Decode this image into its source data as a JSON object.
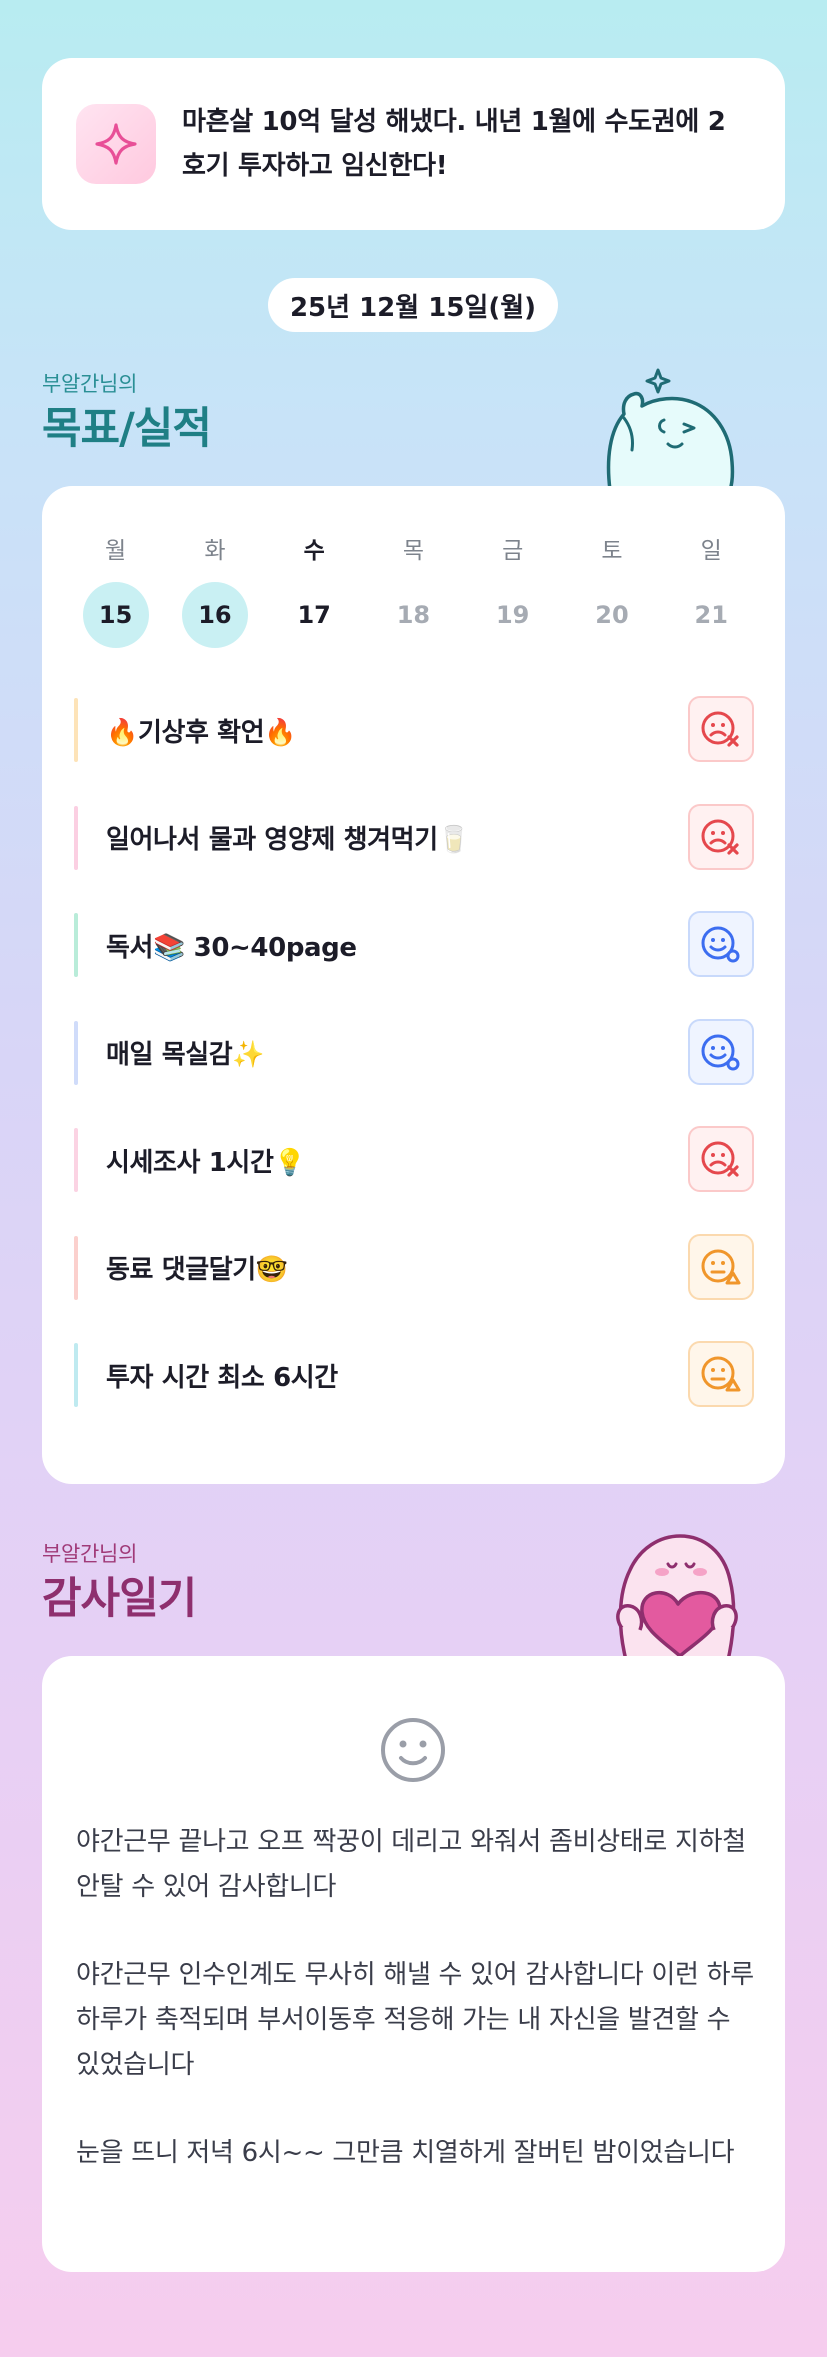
{
  "goal_banner": {
    "icon": "sparkle-icon",
    "text": "마흔살 10억 달성 해냈다. 내년 1월에 수도권에 2호기 투자하고 임신한다!"
  },
  "date": "25년 12월 15일(월)",
  "goals": {
    "owner": "부알간님의",
    "title": "목표/실적",
    "week": [
      {
        "day": "월",
        "date": "15",
        "state": "done"
      },
      {
        "day": "화",
        "date": "16",
        "state": "done"
      },
      {
        "day": "수",
        "date": "17",
        "state": "today"
      },
      {
        "day": "목",
        "date": "18",
        "state": "future"
      },
      {
        "day": "금",
        "date": "19",
        "state": "future"
      },
      {
        "day": "토",
        "date": "20",
        "state": "future"
      },
      {
        "day": "일",
        "date": "21",
        "state": "future"
      }
    ],
    "tasks": [
      {
        "label": "🔥기상후 확언🔥",
        "status": "fail",
        "bar_color": "#fde3b8"
      },
      {
        "label": "일어나서 물과 영양제 챙겨먹기🥛",
        "status": "fail",
        "bar_color": "#fbcfe2"
      },
      {
        "label": "독서📚 30~40page",
        "status": "ok",
        "bar_color": "#b9ecd9"
      },
      {
        "label": "매일 목실감✨",
        "status": "ok",
        "bar_color": "#d0dcfa"
      },
      {
        "label": "시세조사 1시간💡",
        "status": "fail",
        "bar_color": "#fbd3e3"
      },
      {
        "label": "동료 댓글달기🤓",
        "status": "partial",
        "bar_color": "#fbd0cd"
      },
      {
        "label": "투자 시간 최소 6시간",
        "status": "partial",
        "bar_color": "#bfeaf0"
      }
    ],
    "status_colors": {
      "fail": "#e5484d",
      "ok": "#3c6df0",
      "partial": "#f0962b"
    }
  },
  "thanks": {
    "owner": "부알간님의",
    "title": "감사일기",
    "icon": "smile-icon",
    "entries": [
      "야간근무 끝나고 오프 짝꿍이 데리고 와줘서 좀비상태로 지하철 안탈 수 있어 감사합니다",
      "야간근무 인수인계도 무사히 해낼 수 있어 감사합니다 이런 하루하루가 축적되며 부서이동후 적응해 가는 내 자신을 발견할 수 있었습니다",
      "눈을 뜨니 저녁 6시~~ 그만큼 치열하게 잘버틴 밤이었습니다"
    ]
  }
}
